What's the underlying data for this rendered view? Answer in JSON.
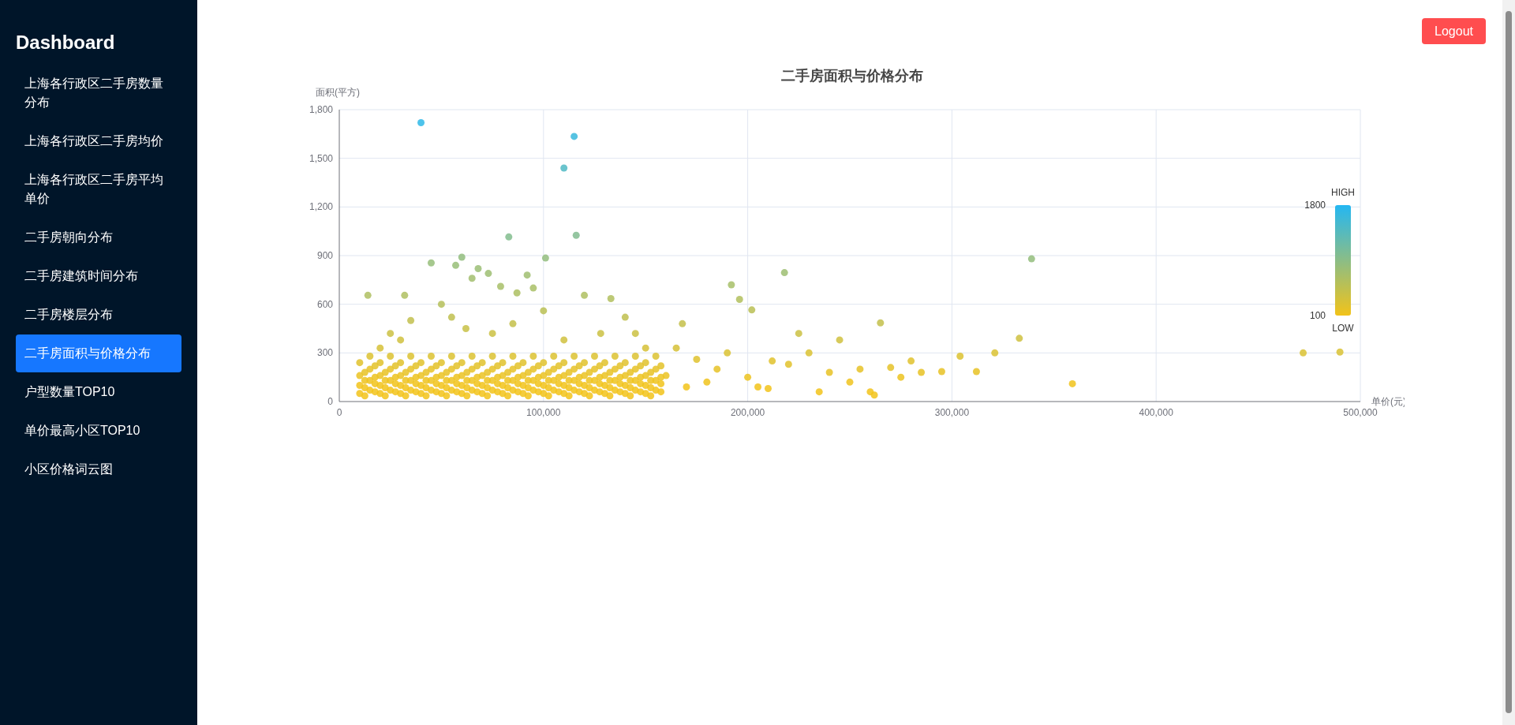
{
  "sidebar": {
    "title": "Dashboard",
    "items": [
      {
        "label": "上海各行政区二手房数量分布",
        "selected": false
      },
      {
        "label": "上海各行政区二手房均价",
        "selected": false
      },
      {
        "label": "上海各行政区二手房平均单价",
        "selected": false
      },
      {
        "label": "二手房朝向分布",
        "selected": false
      },
      {
        "label": "二手房建筑时间分布",
        "selected": false
      },
      {
        "label": "二手房楼层分布",
        "selected": false
      },
      {
        "label": "二手房面积与价格分布",
        "selected": true
      },
      {
        "label": "户型数量TOP10",
        "selected": false
      },
      {
        "label": "单价最高小区TOP10",
        "selected": false
      },
      {
        "label": "小区价格词云图",
        "selected": false
      }
    ]
  },
  "header": {
    "logout": "Logout"
  },
  "chart_data": {
    "type": "scatter",
    "title": "二手房面积与价格分布",
    "xlabel": "单价(元)",
    "ylabel": "面积(平方)",
    "xlim": [
      0,
      500000
    ],
    "ylim": [
      0,
      1800
    ],
    "xticks": [
      {
        "value": 0,
        "label": "0"
      },
      {
        "value": 100000,
        "label": "100,000"
      },
      {
        "value": 200000,
        "label": "200,000"
      },
      {
        "value": 300000,
        "label": "300,000"
      },
      {
        "value": 400000,
        "label": "400,000"
      },
      {
        "value": 500000,
        "label": "500,000"
      }
    ],
    "yticks": [
      {
        "value": 0,
        "label": "0"
      },
      {
        "value": 300,
        "label": "300"
      },
      {
        "value": 600,
        "label": "600"
      },
      {
        "value": 900,
        "label": "900"
      },
      {
        "value": 1200,
        "label": "1,200"
      },
      {
        "value": 1500,
        "label": "1,500"
      },
      {
        "value": 1800,
        "label": "1,800"
      }
    ],
    "grid": true,
    "x": [
      10000,
      10000,
      10000,
      10000,
      15000,
      15000,
      15000,
      15000,
      20000,
      20000,
      20000,
      20000,
      25000,
      25000,
      25000,
      25000,
      30000,
      30000,
      30000,
      30000,
      35000,
      35000,
      35000,
      35000,
      40000,
      40000,
      40000,
      40000,
      45000,
      45000,
      45000,
      45000,
      50000,
      50000,
      50000,
      50000,
      55000,
      55000,
      55000,
      55000,
      60000,
      60000,
      60000,
      60000,
      65000,
      65000,
      65000,
      65000,
      70000,
      70000,
      70000,
      70000,
      75000,
      75000,
      75000,
      75000,
      80000,
      80000,
      80000,
      80000,
      85000,
      85000,
      85000,
      85000,
      90000,
      90000,
      90000,
      90000,
      95000,
      95000,
      95000,
      95000,
      100000,
      100000,
      100000,
      100000,
      105000,
      105000,
      105000,
      105000,
      110000,
      110000,
      110000,
      110000,
      115000,
      115000,
      115000,
      115000,
      120000,
      120000,
      120000,
      120000,
      125000,
      125000,
      125000,
      125000,
      130000,
      130000,
      130000,
      130000,
      135000,
      135000,
      135000,
      135000,
      140000,
      140000,
      140000,
      140000,
      145000,
      145000,
      145000,
      145000,
      150000,
      150000,
      150000,
      150000,
      155000,
      155000,
      155000,
      155000,
      40000,
      115000,
      110000,
      83000,
      116000,
      101000,
      60000,
      45000,
      57000,
      14000,
      32000,
      68000,
      73000,
      65000,
      79000,
      92000,
      95000,
      87000,
      120000,
      133000,
      196000,
      192000,
      218000,
      202000,
      339000,
      333000,
      321000,
      295000,
      304000,
      312000,
      359000,
      472000,
      490000,
      265000,
      270000,
      260000,
      250000,
      230000,
      240000,
      212000,
      205000,
      185000,
      175000,
      168000,
      180000,
      225000,
      140000,
      145000,
      50000,
      55000,
      35000,
      25000,
      85000,
      100000,
      128000,
      160000,
      165000,
      170000,
      190000,
      200000,
      210000,
      220000,
      235000,
      245000,
      255000,
      262000,
      275000,
      280000,
      285000,
      20000,
      30000,
      62000,
      75000,
      110000,
      150000,
      12500,
      12500,
      12500,
      12500,
      17500,
      17500,
      17500,
      17500,
      22500,
      22500,
      22500,
      22500,
      27500,
      27500,
      27500,
      27500,
      32500,
      32500,
      32500,
      32500,
      37500,
      37500,
      37500,
      37500,
      42500,
      42500,
      42500,
      42500,
      47500,
      47500,
      47500,
      47500,
      52500,
      52500,
      52500,
      52500,
      57500,
      57500,
      57500,
      57500,
      62500,
      62500,
      62500,
      62500,
      67500,
      67500,
      67500,
      67500,
      72500,
      72500,
      72500,
      72500,
      77500,
      77500,
      77500,
      77500,
      82500,
      82500,
      82500,
      82500,
      87500,
      87500,
      87500,
      87500,
      92500,
      92500,
      92500,
      92500,
      97500,
      97500,
      97500,
      97500,
      102500,
      102500,
      102500,
      102500,
      107500,
      107500,
      107500,
      107500,
      112500,
      112500,
      112500,
      112500,
      117500,
      117500,
      117500,
      117500,
      122500,
      122500,
      122500,
      122500,
      127500,
      127500,
      127500,
      127500,
      132500,
      132500,
      132500,
      132500,
      137500,
      137500,
      137500,
      137500,
      142500,
      142500,
      142500,
      142500,
      147500,
      147500,
      147500,
      147500,
      152500,
      152500,
      152500,
      152500,
      157500,
      157500,
      157500,
      157500
    ],
    "values": [
      50,
      100,
      160,
      240,
      70,
      130,
      200,
      280,
      50,
      100,
      160,
      240,
      70,
      130,
      200,
      280,
      50,
      100,
      160,
      240,
      70,
      130,
      200,
      280,
      50,
      100,
      160,
      240,
      70,
      130,
      200,
      280,
      50,
      100,
      160,
      240,
      70,
      130,
      200,
      280,
      50,
      100,
      160,
      240,
      70,
      130,
      200,
      280,
      50,
      100,
      160,
      240,
      70,
      130,
      200,
      280,
      50,
      100,
      160,
      240,
      70,
      130,
      200,
      280,
      50,
      100,
      160,
      240,
      70,
      130,
      200,
      280,
      50,
      100,
      160,
      240,
      70,
      130,
      200,
      280,
      50,
      100,
      160,
      240,
      70,
      130,
      200,
      280,
      50,
      100,
      160,
      240,
      70,
      130,
      200,
      280,
      50,
      100,
      160,
      240,
      70,
      130,
      200,
      280,
      50,
      100,
      160,
      240,
      70,
      130,
      200,
      280,
      50,
      100,
      160,
      240,
      70,
      130,
      200,
      280,
      1720,
      1635,
      1440,
      1015,
      1025,
      885,
      890,
      855,
      840,
      655,
      655,
      820,
      790,
      760,
      710,
      780,
      700,
      670,
      655,
      635,
      630,
      720,
      795,
      565,
      880,
      390,
      300,
      185,
      280,
      185,
      110,
      300,
      305,
      485,
      210,
      60,
      120,
      300,
      180,
      250,
      90,
      200,
      260,
      480,
      120,
      420,
      520,
      420,
      600,
      520,
      500,
      420,
      480,
      560,
      420,
      160,
      330,
      90,
      300,
      150,
      80,
      230,
      60,
      380,
      200,
      40,
      150,
      250,
      180,
      330,
      380,
      450,
      420,
      380,
      330,
      35,
      85,
      130,
      180,
      60,
      110,
      150,
      220,
      35,
      85,
      130,
      180,
      60,
      110,
      150,
      220,
      35,
      85,
      130,
      180,
      60,
      110,
      150,
      220,
      35,
      85,
      130,
      180,
      60,
      110,
      150,
      220,
      35,
      85,
      130,
      180,
      60,
      110,
      150,
      220,
      35,
      85,
      130,
      180,
      60,
      110,
      150,
      220,
      35,
      85,
      130,
      180,
      60,
      110,
      150,
      220,
      35,
      85,
      130,
      180,
      60,
      110,
      150,
      220,
      35,
      85,
      130,
      180,
      60,
      110,
      150,
      220,
      35,
      85,
      130,
      180,
      60,
      110,
      150,
      220,
      35,
      85,
      130,
      180,
      60,
      110,
      150,
      220,
      35,
      85,
      130,
      180,
      60,
      110,
      150,
      220,
      35,
      85,
      130,
      180,
      60,
      110,
      150,
      220,
      35,
      85,
      130,
      180,
      60,
      110,
      150,
      220,
      35,
      85,
      130,
      180,
      60,
      110,
      150,
      220
    ]
  },
  "color_legend": {
    "min_label": "100",
    "max_label": "1800",
    "low_label": "LOW",
    "high_label": "HIGH"
  }
}
